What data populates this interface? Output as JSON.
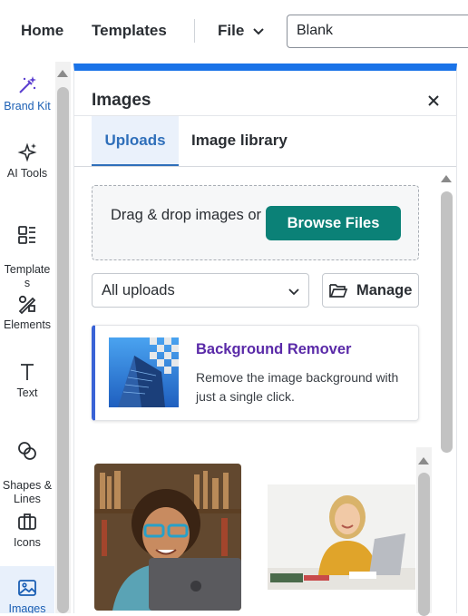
{
  "header": {
    "home_label": "Home",
    "templates_label": "Templates",
    "file_label": "File",
    "document_name": "Blank"
  },
  "sidebar": {
    "items": [
      {
        "label": "Brand Kit",
        "icon": "magic-wand-icon"
      },
      {
        "label": "AI Tools",
        "icon": "sparkle-icon"
      },
      {
        "label": "Template\ns",
        "icon": "layout-template-icon"
      },
      {
        "label": "Elements",
        "icon": "shapes-pen-icon"
      },
      {
        "label": "Text",
        "icon": "text-t-icon"
      },
      {
        "label": "Shapes &\nLines",
        "icon": "overlapping-circles-icon"
      },
      {
        "label": "Icons",
        "icon": "briefcase-icon"
      },
      {
        "label": "Images",
        "icon": "image-icon",
        "active": true
      }
    ]
  },
  "panel": {
    "title": "Images",
    "tabs": [
      {
        "label": "Uploads",
        "active": true
      },
      {
        "label": "Image library",
        "active": false
      }
    ],
    "dropzone": {
      "text": "Drag & drop images or",
      "button_label": "Browse Files"
    },
    "filter": {
      "selected": "All uploads"
    },
    "manage_label": "Manage",
    "promo": {
      "title": "Background Remover",
      "description": "Remove the image background with just a single click."
    },
    "images": [
      {
        "icon": "photo-boy-laptop"
      },
      {
        "icon": "photo-girl-laptop"
      }
    ]
  },
  "colors": {
    "accent_blue": "#1a73e8",
    "tab_active": "#2f6fba",
    "browse_button": "#0b8177",
    "promo_title": "#5a2aa8"
  }
}
